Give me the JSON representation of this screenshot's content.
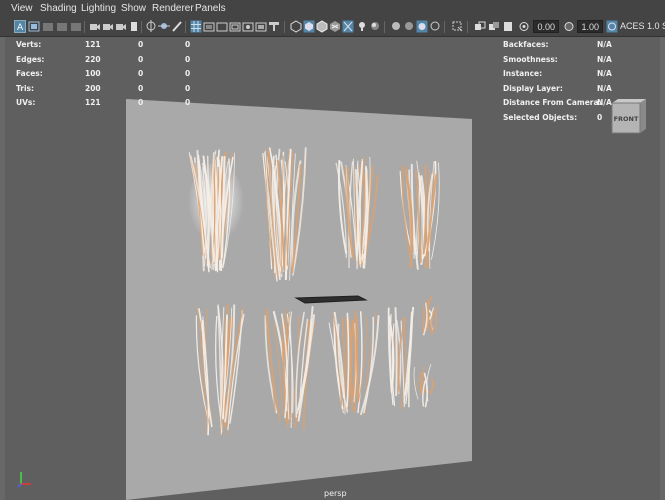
{
  "menu": [
    "View",
    "Shading",
    "Lighting",
    "Show",
    "Renderer",
    "Panels"
  ],
  "toolbar": {
    "exposure": "0.00",
    "gamma": "1.00",
    "color_space": "ACES 1.0 S"
  },
  "hud_left": [
    {
      "label": "Verts:",
      "v1": "121",
      "v2": "0",
      "v3": "0"
    },
    {
      "label": "Edges:",
      "v1": "220",
      "v2": "0",
      "v3": "0"
    },
    {
      "label": "Faces:",
      "v1": "100",
      "v2": "0",
      "v3": "0"
    },
    {
      "label": "Tris:",
      "v1": "200",
      "v2": "0",
      "v3": "0"
    },
    {
      "label": "UVs:",
      "v1": "121",
      "v2": "0",
      "v3": "0"
    }
  ],
  "hud_right": [
    {
      "label": "Backfaces:",
      "value": "N/A"
    },
    {
      "label": "Smoothness:",
      "value": "N/A"
    },
    {
      "label": "Instance:",
      "value": "N/A"
    },
    {
      "label": "Display Layer:",
      "value": "N/A"
    },
    {
      "label": "Distance From Camera:",
      "value": "N/A"
    },
    {
      "label": "Selected Objects:",
      "value": "0"
    }
  ],
  "view_cube_label": "FRONT",
  "camera_label": "persp",
  "colors": {
    "menubar_bg": "#444444",
    "viewport_bg": "#5f5f5f",
    "plane": "#a9a9a9",
    "hair_light": "#f4eee7",
    "hair_orange": "#d9a273",
    "accent": "#5285a6"
  },
  "icons": [
    "select-icon",
    "grid-icon",
    "camera-icon",
    "wireframe-icon",
    "shaded-icon",
    "light-icon",
    "xray-icon",
    "isolate-icon"
  ]
}
